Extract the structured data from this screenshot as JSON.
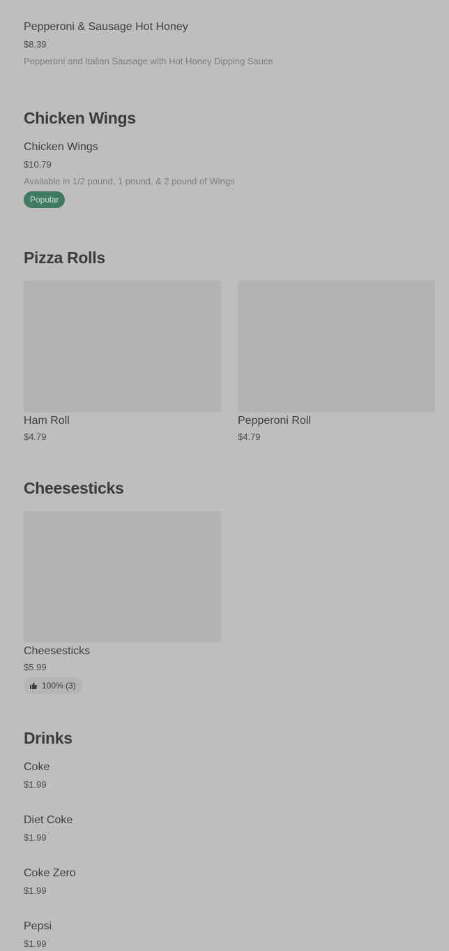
{
  "menu": {
    "hot_honey": {
      "name": "Pepperoni & Sausage Hot Honey",
      "price": "$8.39",
      "description": "Pepperoni and Italian Sausage with Hot Honey Dipping Sauce"
    },
    "chicken_wings_section": {
      "title": "Chicken Wings",
      "item": {
        "name": "Chicken Wings",
        "price": "$10.79",
        "description": "Available in 1/2 pound, 1 pound, & 2 pound of Wings",
        "badge": "Popular"
      }
    },
    "pizza_rolls_section": {
      "title": "Pizza Rolls",
      "items": [
        {
          "name": "Ham Roll",
          "price": "$4.79"
        },
        {
          "name": "Pepperoni Roll",
          "price": "$4.79"
        }
      ]
    },
    "cheesesticks_section": {
      "title": "Cheesesticks",
      "item": {
        "name": "Cheesesticks",
        "price": "$5.99",
        "rating": "100% (3)",
        "rating_icon": "thumbs-up-icon"
      }
    },
    "drinks_section": {
      "title": "Drinks",
      "items": [
        {
          "name": "Coke",
          "price": "$1.99"
        },
        {
          "name": "Diet Coke",
          "price": "$1.99"
        },
        {
          "name": "Coke Zero",
          "price": "$1.99"
        },
        {
          "name": "Pepsi",
          "price": "$1.99"
        }
      ]
    }
  },
  "colors": {
    "page_background": "#bebebe",
    "popular_badge": "#3f7a63",
    "image_placeholder": "#b3b3b3"
  }
}
